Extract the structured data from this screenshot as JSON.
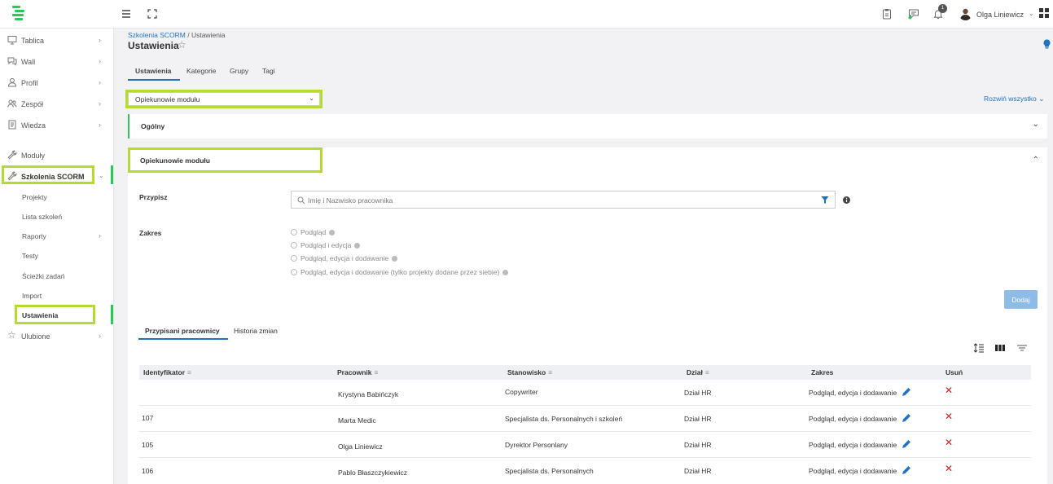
{
  "user": {
    "name": "Olga Liniewicz",
    "notifications": "1"
  },
  "sidebar": {
    "items": [
      {
        "label": "Tablica",
        "icon": "monitor-icon"
      },
      {
        "label": "Wall",
        "icon": "chat-icon"
      },
      {
        "label": "Profil",
        "icon": "user-icon"
      },
      {
        "label": "Zespół",
        "icon": "team-icon"
      },
      {
        "label": "Wiedza",
        "icon": "book-icon"
      },
      {
        "label": "Moduły",
        "icon": "wrench-icon"
      },
      {
        "label": "Szkolenia SCORM",
        "icon": "wrench-icon"
      },
      {
        "label": "Ulubione",
        "icon": "star-icon"
      }
    ],
    "sub_items": [
      "Projekty",
      "Lista szkoleń",
      "Raporty",
      "Testy",
      "Ścieżki zadań",
      "Import",
      "Ustawienia"
    ]
  },
  "breadcrumb": {
    "link": "Szkolenia SCORM",
    "current": "/ Ustawienia"
  },
  "page_title": "Ustawienia",
  "tabs": [
    "Ustawienia",
    "Kategorie",
    "Grupy",
    "Tagi"
  ],
  "section_select": {
    "value": "Opiekunowie modułu"
  },
  "expand_all": "Rozwiń wszystko",
  "panels": {
    "general": "Ogólny",
    "guardians": "Opiekunowie modułu"
  },
  "form": {
    "assign_label": "Przypisz",
    "search_placeholder": "Imię i Nazwisko pracownika",
    "scope_label": "Zakres",
    "scope_options": [
      "Podgląd",
      "Podgląd i edycja",
      "Podgląd, edycja i dodawanie",
      "Podgląd, edycja i dodawanie (tylko projekty dodane przez siebie)"
    ],
    "add_button": "Dodaj"
  },
  "sub_tabs": [
    "Przypisani pracownicy",
    "Historia zmian"
  ],
  "table": {
    "columns": [
      "Identyfikator",
      "Pracownik",
      "Stanowisko",
      "Dział",
      "Zakres",
      "Usuń"
    ],
    "rows": [
      {
        "id": "",
        "employee": "Krystyna Babińczyk",
        "position": "Copywriter",
        "department": "Dział HR",
        "scope": "Podgląd, edycja i dodawanie"
      },
      {
        "id": "107",
        "employee": "Marta Medic",
        "position": "Specjalista ds. Personalnych i szkoleń",
        "department": "Dział HR",
        "scope": "Podgląd, edycja i dodawanie"
      },
      {
        "id": "105",
        "employee": "Olga Liniewicz",
        "position": "Dyrektor Personlany",
        "department": "Dział HR",
        "scope": "Podgląd, edycja i dodawanie"
      },
      {
        "id": "106",
        "employee": "Pablo Błaszczykiewicz",
        "position": "Specjalista ds. Personalnych",
        "department": "Dział HR",
        "scope": "Podgląd, edycja i dodawanie"
      }
    ]
  },
  "colors": {
    "accent": "#1f72c4",
    "highlight": "#b4dc2c",
    "brand": "#2ec55b",
    "danger": "#d32020"
  }
}
